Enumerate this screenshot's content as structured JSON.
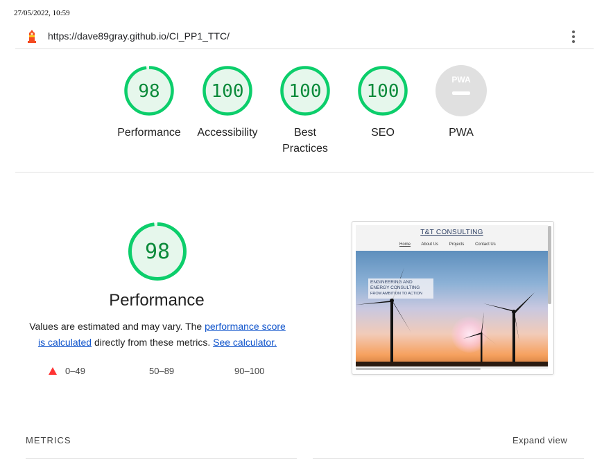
{
  "print_header": {
    "datetime": "27/05/2022, 10:59"
  },
  "urlbar": {
    "logo_icon": "lighthouse-icon",
    "url": "https://dave89gray.github.io/CI_PP1_TTC/",
    "menu_icon": "kebab-menu-icon"
  },
  "gauges": [
    {
      "label": "Performance",
      "score": "98",
      "fraction": 0.98,
      "color": "#0cce6b"
    },
    {
      "label": "Accessibility",
      "score": "100",
      "fraction": 1.0,
      "color": "#0cce6b"
    },
    {
      "label": "Best Practices",
      "score": "100",
      "fraction": 1.0,
      "color": "#0cce6b"
    },
    {
      "label": "SEO",
      "score": "100",
      "fraction": 1.0,
      "color": "#0cce6b"
    },
    {
      "label": "PWA",
      "badge": "PWA",
      "color": "#cccccc"
    }
  ],
  "performance": {
    "score": "98",
    "fraction": 0.98,
    "title": "Performance",
    "desc_prefix": "Values are estimated and may vary. The ",
    "desc_link": "performance score is calculated",
    "desc_middle": " directly from these metrics. ",
    "desc_link2": "See calculator.",
    "legend": {
      "fail": "0–49",
      "average": "50–89",
      "pass": "90–100"
    }
  },
  "screenshot": {
    "site_title": "T&T CONSULTING",
    "nav": [
      "Home",
      "About Us",
      "Projects",
      "Contact Us"
    ],
    "caption_lines": [
      "ENGINEERING AND",
      "ENERGY CONSULTING",
      "FROM AMBITION TO ACTION"
    ]
  },
  "metrics": {
    "heading": "METRICS",
    "expand_label": "Expand view"
  },
  "colors": {
    "pass": "#0cce6b",
    "pass_text": "#0b8a3a",
    "fail": "#ff3333",
    "link": "#1155cc"
  }
}
